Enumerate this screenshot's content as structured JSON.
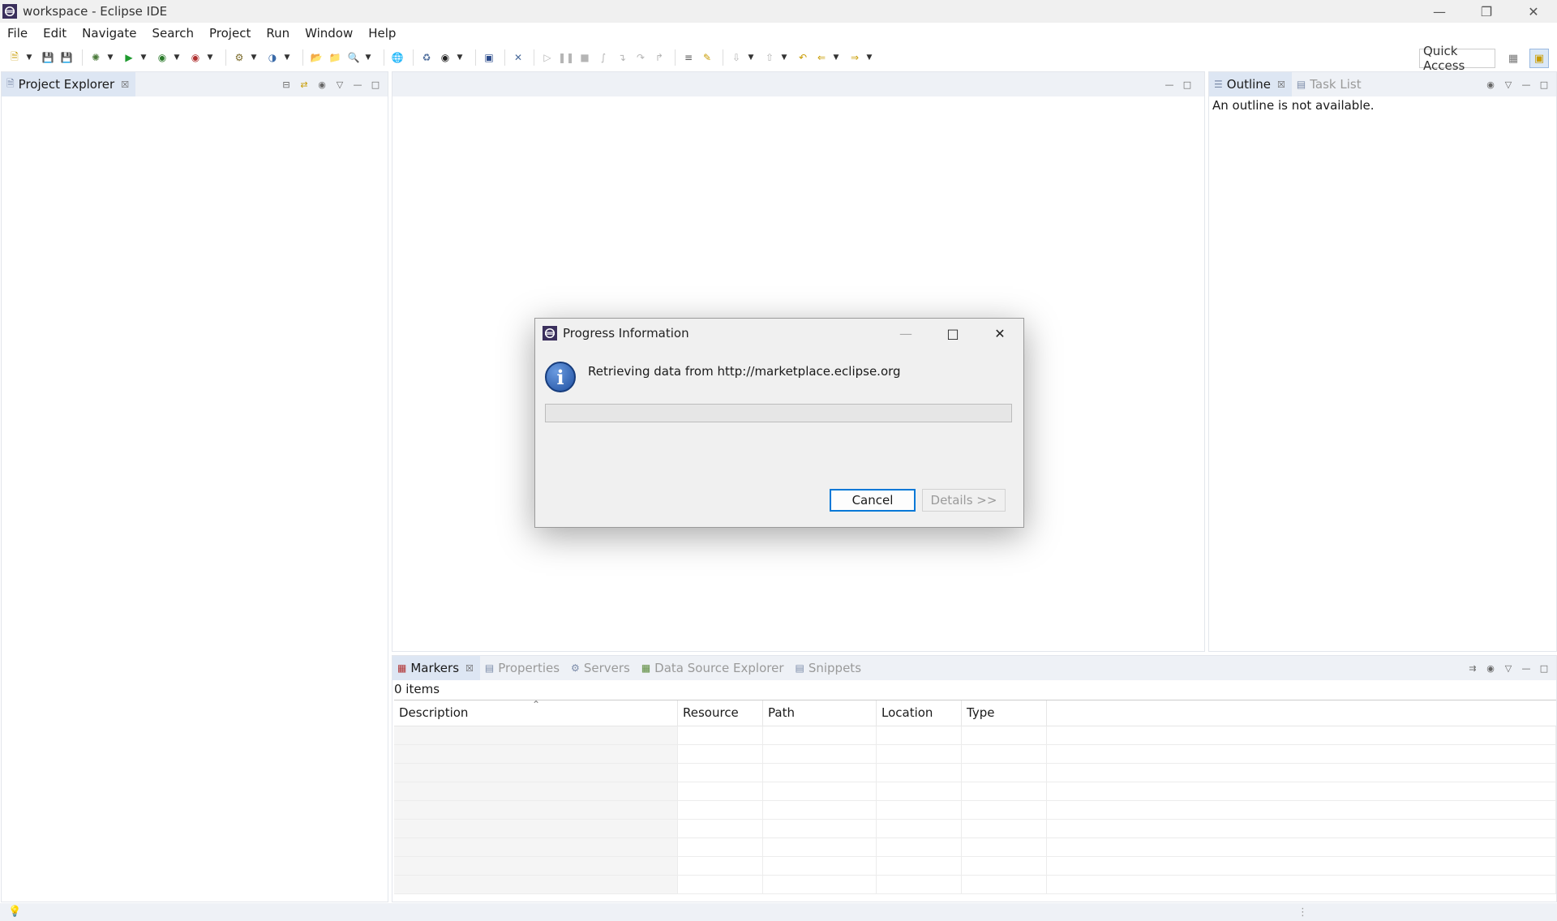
{
  "window": {
    "title": "workspace - Eclipse IDE",
    "minimize_icon": "minimize-icon",
    "restore_icon": "restore-icon",
    "close_icon": "close-icon"
  },
  "menu": [
    "File",
    "Edit",
    "Navigate",
    "Search",
    "Project",
    "Run",
    "Window",
    "Help"
  ],
  "toolbar": {
    "quick_access": "Quick Access",
    "icons": [
      "new-icon",
      "save-icon",
      "save-all-icon",
      "debug-icon",
      "run-icon",
      "coverage-icon",
      "external-tools-icon",
      "new-server-icon",
      "new-class-icon",
      "open-type-icon",
      "open-folder-icon",
      "search-icon",
      "web-browser-icon",
      "dependency-icon",
      "profile-icon",
      "terminal-icon",
      "pin-icon",
      "resume-icon",
      "suspend-icon",
      "terminate-icon",
      "disconnect-icon",
      "step-into-icon",
      "step-over-icon",
      "step-return-icon",
      "toggle-ws-icon",
      "mark-occurrences-icon",
      "next-annotation-icon",
      "prev-annotation-icon",
      "last-edit-icon",
      "back-icon",
      "forward-icon"
    ]
  },
  "project_explorer": {
    "tab_label": "Project Explorer"
  },
  "outline": {
    "tab_outline": "Outline",
    "tab_tasks": "Task List",
    "message": "An outline is not available."
  },
  "bottom": {
    "tabs": [
      "Markers",
      "Properties",
      "Servers",
      "Data Source Explorer",
      "Snippets"
    ],
    "items_count": "0 items",
    "columns": [
      "Description",
      "Resource",
      "Path",
      "Location",
      "Type"
    ]
  },
  "dialog": {
    "title": "Progress Information",
    "message": "Retrieving data from http://marketplace.eclipse.org",
    "progress_fraction": 0,
    "cancel_label": "Cancel",
    "details_label": "Details >>"
  },
  "colors": {
    "accent": "#0078d7",
    "panel_header": "#eef1f6",
    "active_tab": "#dde6f3"
  }
}
